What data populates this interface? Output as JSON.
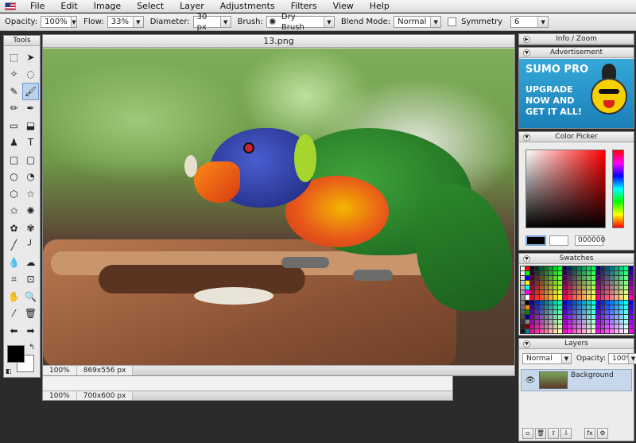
{
  "menubar": {
    "items": [
      "File",
      "Edit",
      "Image",
      "Select",
      "Layer",
      "Adjustments",
      "Filters",
      "View",
      "Help"
    ]
  },
  "options": {
    "opacity_label": "Opacity:",
    "opacity_value": "100%",
    "flow_label": "Flow:",
    "flow_value": "33%",
    "diameter_label": "Diameter:",
    "diameter_value": "30 px",
    "brush_label": "Brush:",
    "brush_value": "Dry Brush",
    "blend_label": "Blend Mode:",
    "blend_value": "Normal",
    "symmetry_label": "Symmetry",
    "symmetry_value": "6"
  },
  "tools": {
    "title": "Tools",
    "icons": [
      "marquee-icon",
      "move-arrow-icon",
      "magic-wand-icon",
      "lasso-icon",
      "pencil-icon",
      "brush-icon",
      "eraser-icon",
      "pen-icon",
      "gradient-icon",
      "bucket-icon",
      "stamp-icon",
      "text-icon",
      "rectangle-icon",
      "rounded-rect-icon",
      "ellipse-icon",
      "speech-bubble-icon",
      "hexagon-icon",
      "star-icon",
      "star-outline-icon",
      "burst-icon",
      "gear-shape-icon",
      "flower-icon",
      "line-icon",
      "curve-icon",
      "drop-icon",
      "smudge-icon",
      "crop-icon",
      "resize-icon",
      "hand-icon",
      "zoom-icon",
      "eyedropper-icon",
      "trash-icon",
      "arrow-left-icon",
      "arrow-right-icon"
    ],
    "glyphs": [
      "⬚",
      "➤",
      "✧",
      "◌",
      "✎",
      "🖌",
      "✏",
      "✒",
      "▭",
      "⬓",
      "♟",
      "T",
      "□",
      "▢",
      "○",
      "◔",
      "⬡",
      "☆",
      "✩",
      "✺",
      "✿",
      "✾",
      "╱",
      "╯",
      "💧",
      "☁",
      "⌗",
      "⊡",
      "✋",
      "🔍",
      "⁄",
      "🗑",
      "⬅",
      "➡"
    ],
    "active_index": 5
  },
  "canvas": {
    "title": "13.png",
    "zoom": "100%",
    "size": "869x556 px"
  },
  "canvas2": {
    "zoom": "100%",
    "size": "700x600 px"
  },
  "panels": {
    "info_title": "Info / Zoom",
    "ad_title": "Advertisement",
    "ad_brand": "SUMO PRO",
    "ad_message_1": "UPGRADE",
    "ad_message_2": "NOW AND",
    "ad_message_3": "GET IT ALL!",
    "picker_title": "Color Picker",
    "picker_hex": "000000",
    "swatches_title": "Swatches",
    "layers_title": "Layers",
    "layers_blend": "Normal",
    "layers_opacity_label": "Opacity:",
    "layers_opacity": "100%",
    "layer_name": "Background"
  }
}
